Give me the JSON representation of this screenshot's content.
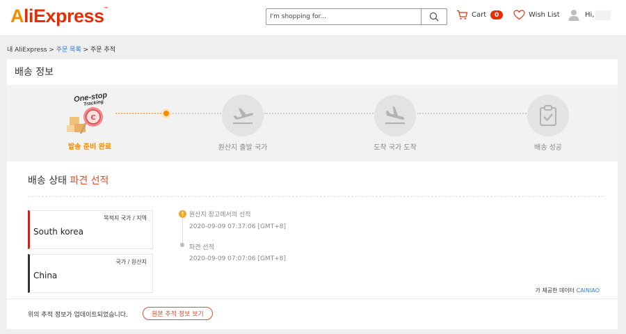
{
  "header": {
    "logo_text": "AliExpress",
    "logo_tm": "™",
    "search_placeholder": "I'm shopping for...",
    "cart_label": "Cart",
    "cart_count": "0",
    "wishlist_label": "Wish List",
    "user_greeting": "Hi,"
  },
  "breadcrumb": {
    "home": "내 AliExpress",
    "sep1": ">",
    "orders": "주문 목록",
    "sep2": ">",
    "current": "주문 추적"
  },
  "card": {
    "title": "배송 정보",
    "one_stop": "One-stop",
    "tracking": "Tracking",
    "steps": [
      {
        "label": "발송 준비 완료",
        "icon": "one-stop-tracking-illustration"
      },
      {
        "label": "원산지 출발 국가",
        "icon": "plane-takeoff-icon"
      },
      {
        "label": "도착 국가 도착",
        "icon": "plane-landing-icon"
      },
      {
        "label": "배송 성공",
        "icon": "clipboard-check-icon"
      }
    ],
    "status_prefix": "배송 상태",
    "status_value": "파견 선적",
    "destination": {
      "caption": "목적지 국가 / 지역",
      "value": "South korea"
    },
    "origin": {
      "caption": "국가 / 원산지",
      "value": "China"
    },
    "events": [
      {
        "title": "원산지 창고에서의 선적",
        "time": "2020-09-09 07:37:06 [GMT+8]"
      },
      {
        "title": "파견 선적",
        "time": "2020-09-09 07:07:06 [GMT+8]"
      }
    ],
    "source_prefix": "가 제공한 데이터",
    "source_brand": "CAINIAO",
    "footer_text": "위의 추적 정보가 업데이트되었습니다.",
    "raw_button": "원본 추적 정보 보기"
  },
  "colors": {
    "brand_red": "#e62e04",
    "brand_orange": "#f28b00",
    "status_red": "#e34b2a",
    "link_blue": "#2e7dd1"
  }
}
